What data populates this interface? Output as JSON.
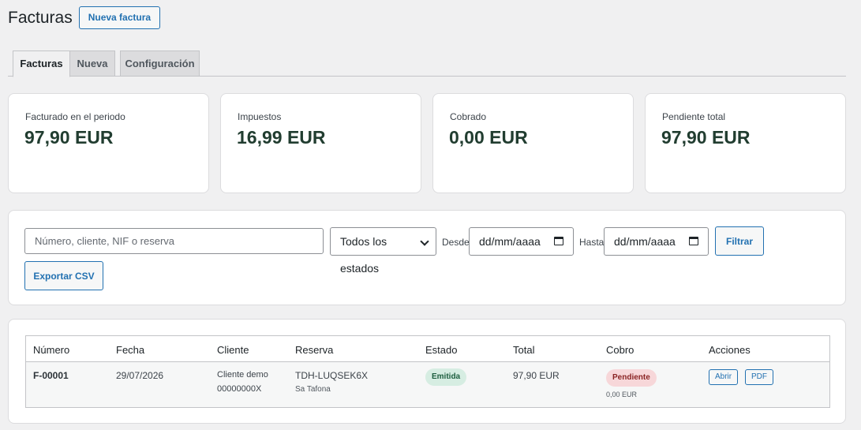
{
  "header": {
    "title": "Facturas",
    "new_button": "Nueva factura"
  },
  "tabs": [
    {
      "label": "Facturas",
      "active": true
    },
    {
      "label": "Nueva",
      "active": false
    },
    {
      "label": "Configuración",
      "active": false
    }
  ],
  "stats": [
    {
      "label": "Facturado en el periodo",
      "value": "97,90 EUR"
    },
    {
      "label": "Impuestos",
      "value": "16,99 EUR"
    },
    {
      "label": "Cobrado",
      "value": "0,00 EUR"
    },
    {
      "label": "Pendiente total",
      "value": "97,90 EUR"
    }
  ],
  "filters": {
    "search_placeholder": "Número, cliente, NIF o reserva",
    "status_selected": "Todos los estados",
    "from_label": "Desde",
    "from_value": "dd/mm/aaaa",
    "to_label": "Hasta",
    "to_value": "dd/mm/aaaa",
    "filter_button": "Filtrar",
    "export_button": "Exportar CSV"
  },
  "table": {
    "columns": [
      "Número",
      "Fecha",
      "Cliente",
      "Reserva",
      "Estado",
      "Total",
      "Cobro",
      "Acciones"
    ],
    "rows": [
      {
        "number": "F-00001",
        "date": "29/07/2026",
        "client_name": "Cliente demo",
        "client_nif": "00000000X",
        "booking_code": "TDH-LUQSEK6X",
        "booking_place": "Sa Tafona",
        "status": "Emitida",
        "total": "97,90 EUR",
        "payment_status": "Pendiente",
        "payment_amount": "0,00 EUR",
        "actions": [
          "Abrir",
          "PDF"
        ]
      }
    ]
  },
  "colors": {
    "accent": "#2271b1",
    "value_text": "#213d30",
    "badge_green": "#d6ede2",
    "badge_red": "#f7d7d9"
  },
  "icons": {
    "status_dropdown": "chevron-down-icon",
    "date_picker": "calendar-icon"
  }
}
